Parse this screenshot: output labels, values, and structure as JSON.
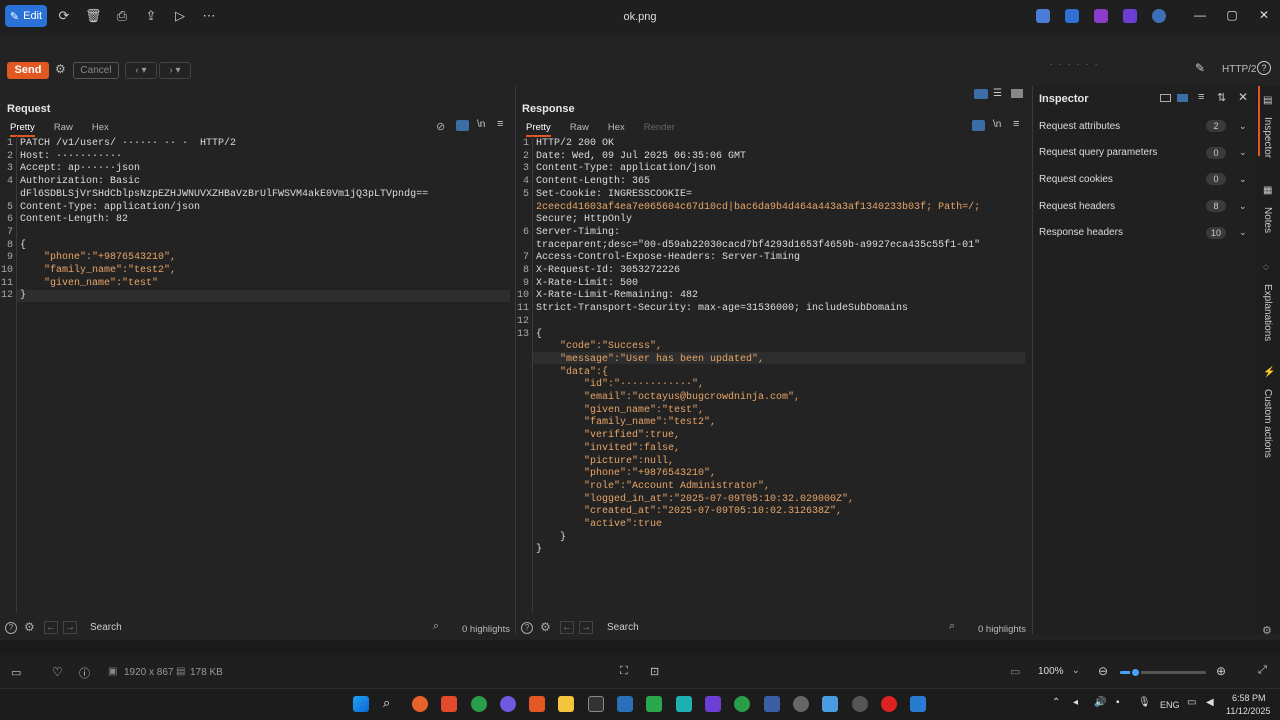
{
  "viewer": {
    "edit_label": "Edit",
    "filename": "ok.png",
    "icons": [
      "rotate-icon",
      "delete-icon",
      "print-icon",
      "share-icon",
      "slideshow-icon",
      "more-icon"
    ],
    "window_controls": [
      "—",
      "▢",
      "✕"
    ]
  },
  "burp": {
    "send_label": "Send",
    "cancel_label": "Cancel",
    "http_version": "HTTP/2",
    "request": {
      "title": "Request",
      "tabs": [
        "Pretty",
        "Raw",
        "Hex"
      ],
      "active_tab": "Pretty",
      "lines": [
        {
          "n": "1",
          "t": "PATCH /v1/users/ ······ ·· ·  HTTP/2"
        },
        {
          "n": "2",
          "t": "Host: ···········"
        },
        {
          "n": "3",
          "t": "Accept: ap······json"
        },
        {
          "n": "4",
          "t": "Authorization: Basic"
        },
        {
          "n": "",
          "t": "dFl6SDBLSjVrSHdCblpsNzpEZHJWNUVXZHBaVzBrUlFWSVM4akE0Vm1jQ3pLTVpndg=="
        },
        {
          "n": "5",
          "t": "Content-Type: application/json"
        },
        {
          "n": "6",
          "t": "Content-Length: 82"
        },
        {
          "n": "7",
          "t": ""
        },
        {
          "n": "8",
          "t": "{"
        },
        {
          "n": "9",
          "t": "    \"phone\":\"+9876543210\","
        },
        {
          "n": "10",
          "t": "    \"family_name\":\"test2\","
        },
        {
          "n": "11",
          "t": "    \"given_name\":\"test\""
        },
        {
          "n": "12",
          "t": "}"
        }
      ],
      "search_placeholder": "Search",
      "highlights": "0 highlights"
    },
    "response": {
      "title": "Response",
      "tabs": [
        "Pretty",
        "Raw",
        "Hex",
        "Render"
      ],
      "active_tab": "Pretty",
      "lines": [
        {
          "n": "1",
          "t": "HTTP/2 200 OK"
        },
        {
          "n": "2",
          "t": "Date: Wed, 09 Jul 2025 06:35:06 GMT"
        },
        {
          "n": "3",
          "t": "Content-Type: application/json"
        },
        {
          "n": "4",
          "t": "Content-Length: 365"
        },
        {
          "n": "5",
          "t": "Set-Cookie: INGRESSCOOKIE="
        },
        {
          "n": "",
          "t": "2ceecd41603af4ea7e065604c67d10cd|bac6da9b4d464a443a3af1340233b03f; Path=/;"
        },
        {
          "n": "",
          "t": "Secure; HttpOnly"
        },
        {
          "n": "6",
          "t": "Server-Timing:"
        },
        {
          "n": "",
          "t": "traceparent;desc=\"00-d59ab22030cacd7bf4293d1653f4659b-a9927eca435c55f1-01\""
        },
        {
          "n": "7",
          "t": "Access-Control-Expose-Headers: Server-Timing"
        },
        {
          "n": "8",
          "t": "X-Request-Id: 3053272226"
        },
        {
          "n": "9",
          "t": "X-Rate-Limit: 500"
        },
        {
          "n": "10",
          "t": "X-Rate-Limit-Remaining: 482"
        },
        {
          "n": "11",
          "t": "Strict-Transport-Security: max-age=31536000; includeSubDomains"
        },
        {
          "n": "12",
          "t": ""
        },
        {
          "n": "13",
          "t": "{"
        },
        {
          "n": "",
          "t": "    \"code\":\"Success\","
        },
        {
          "n": "",
          "t": "    \"message\":\"User has been updated\","
        },
        {
          "n": "",
          "t": "    \"data\":{"
        },
        {
          "n": "",
          "t": "        \"id\":\"············\","
        },
        {
          "n": "",
          "t": "        \"email\":\"octayus@bugcrowdninja.com\","
        },
        {
          "n": "",
          "t": "        \"given_name\":\"test\","
        },
        {
          "n": "",
          "t": "        \"family_name\":\"test2\","
        },
        {
          "n": "",
          "t": "        \"verified\":true,"
        },
        {
          "n": "",
          "t": "        \"invited\":false,"
        },
        {
          "n": "",
          "t": "        \"picture\":null,"
        },
        {
          "n": "",
          "t": "        \"phone\":\"+9876543210\","
        },
        {
          "n": "",
          "t": "        \"role\":\"Account Administrator\","
        },
        {
          "n": "",
          "t": "        \"logged_in_at\":\"2025-07-09T05:10:32.029000Z\","
        },
        {
          "n": "",
          "t": "        \"created_at\":\"2025-07-09T05:10:02.312638Z\","
        },
        {
          "n": "",
          "t": "        \"active\":true"
        },
        {
          "n": "",
          "t": "    }"
        },
        {
          "n": "",
          "t": "}"
        }
      ],
      "search_placeholder": "Search",
      "highlights": "0 highlights"
    },
    "inspector": {
      "title": "Inspector",
      "rows": [
        {
          "label": "Request attributes",
          "count": "2"
        },
        {
          "label": "Request query parameters",
          "count": "0"
        },
        {
          "label": "Request cookies",
          "count": "0"
        },
        {
          "label": "Request headers",
          "count": "8"
        },
        {
          "label": "Response headers",
          "count": "10"
        }
      ]
    },
    "rail": [
      "Inspector",
      "Notes",
      "Explanations",
      "Custom actions"
    ]
  },
  "status": {
    "dimensions": "1920 x 867",
    "size": "178 KB",
    "zoom": "100%",
    "zoom_level": 0.18
  },
  "taskbar": {
    "lang": "ENG",
    "time": "6:58 PM",
    "date": "11/12/2025"
  },
  "colors": {
    "accent": "#e25822",
    "edit": "#2a72d8"
  }
}
